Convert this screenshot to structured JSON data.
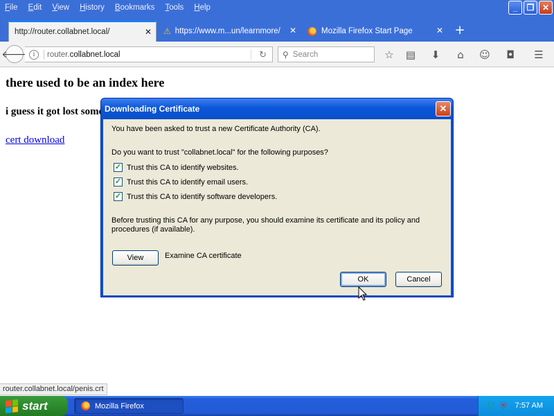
{
  "menubar": {
    "items": [
      "File",
      "Edit",
      "View",
      "History",
      "Bookmarks",
      "Tools",
      "Help"
    ]
  },
  "window_controls": {
    "minimize": "_",
    "maximize": "❐",
    "close": "✕"
  },
  "tabs": [
    {
      "label": "http://router.collabnet.local/",
      "active": true,
      "icon": "none"
    },
    {
      "label": "https://www.m...un/learnmore/",
      "active": false,
      "icon": "warning-icon"
    },
    {
      "label": "Mozilla Firefox Start Page",
      "active": false,
      "icon": "firefox-icon"
    }
  ],
  "new_tab": "+",
  "navbar": {
    "url_prefix": "router.",
    "url_domain": "collabnet.local",
    "search_placeholder": "Search"
  },
  "page": {
    "heading": "there used to be an index here",
    "subheading": "i guess it got lost somewhere",
    "link": "cert download"
  },
  "dialog": {
    "title": "Downloading Certificate",
    "intro": "You have been asked to trust a new Certificate Authority (CA).",
    "question": "Do you want to trust \"collabnet.local\" for the following purposes?",
    "options": [
      {
        "label": "Trust this CA to identify websites.",
        "checked": true
      },
      {
        "label": "Trust this CA to identify email users.",
        "checked": true
      },
      {
        "label": "Trust this CA to identify software developers.",
        "checked": true
      }
    ],
    "warning_line1": "Before trusting this CA for any purpose, you should examine its certificate and its policy and",
    "warning_line2": "procedures (if available).",
    "view_button": "View",
    "view_desc": "Examine CA certificate",
    "ok_button": "OK",
    "cancel_button": "Cancel"
  },
  "statusbar": {
    "text": "router.collabnet.local/penis.crt"
  },
  "taskbar": {
    "start_label": "start",
    "task_item": "Mozilla Firefox",
    "clock": "7:57 AM"
  },
  "colors": {
    "xp_blue": "#245edb",
    "xp_green": "#2d8a2d",
    "dialog_face": "#ece9d8",
    "link": "#0000ee"
  }
}
